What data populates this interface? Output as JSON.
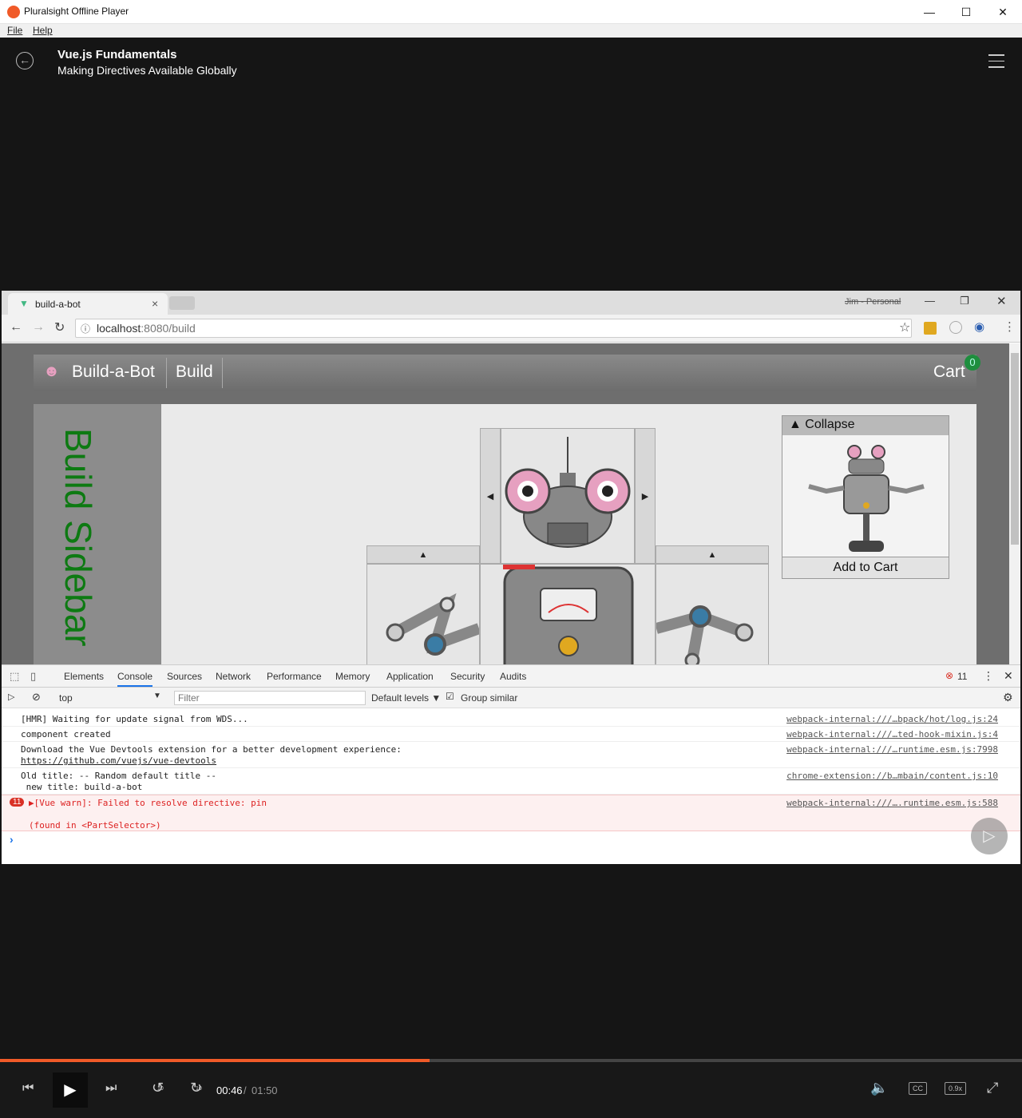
{
  "window": {
    "title": "Pluralsight Offline Player",
    "min": "—",
    "max": "☐",
    "close": "✕"
  },
  "menu": {
    "file": "File",
    "help": "Help"
  },
  "player": {
    "course": "Vue.js Fundamentals",
    "clip": "Making Directives Available Globally",
    "back": "←"
  },
  "browser": {
    "tab_title": "build-a-bot",
    "tab_close": "×",
    "profile": "Jim - Personal",
    "url_host": "localhost",
    "url_path": ":8080/build"
  },
  "app": {
    "brand": "Build-a-Bot",
    "nav_build": "Build",
    "cart_label": "Cart",
    "cart_count": "0",
    "sidebar": "Build Sidebar",
    "collapse": "▲ Collapse",
    "add_to_cart": "Add to Cart",
    "left_arrow": "◀",
    "right_arrow": "▶",
    "up_arrow": "▲"
  },
  "devtools": {
    "tabs": [
      "Elements",
      "Console",
      "Sources",
      "Network",
      "Performance",
      "Memory",
      "Application",
      "Security",
      "Audits"
    ],
    "error_count": "11",
    "context": "top",
    "filter_placeholder": "Filter",
    "levels": "Default levels ▼",
    "group_similar": "Group similar",
    "console": [
      {
        "msg": "[HMR] Waiting for update signal from WDS...",
        "src": "webpack-internal:///…bpack/hot/log.js:24"
      },
      {
        "msg": "component created",
        "src": "webpack-internal:///…ted-hook-mixin.js:4"
      },
      {
        "msg": "Download the Vue Devtools extension for a better development experience:",
        "link": "https://github.com/vuejs/vue-devtools",
        "src": "webpack-internal:///…runtime.esm.js:7998"
      },
      {
        "msg": "Old title: -- Random default title --",
        "msg2": " new title: build-a-bot",
        "src": "chrome-extension://b…mbain/content.js:10"
      }
    ],
    "error": {
      "badge": "11",
      "msg": "▶[Vue warn]: Failed to resolve directive: pin",
      "detail": "(found in <PartSelector>)",
      "src": "webpack-internal:///….runtime.esm.js:588"
    },
    "prompt": "›"
  },
  "playback": {
    "progress": 0.42,
    "current": "00:46",
    "sep": "/",
    "duration": "01:50",
    "skip_back": "10",
    "skip_fwd": "10",
    "cc": "CC",
    "speed": "0.9x"
  },
  "colors": {
    "accent": "#f05a28",
    "sidebar_text": "#0d7a12",
    "error": "#d93025"
  }
}
